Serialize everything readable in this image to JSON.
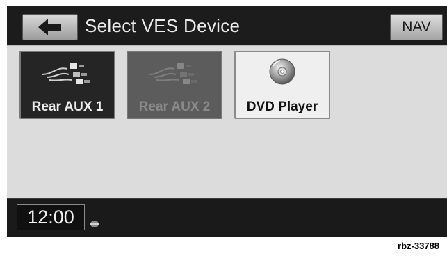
{
  "header": {
    "title": "Select VES Device",
    "back_icon": "arrow-left-icon",
    "nav_label": "NAV"
  },
  "devices": [
    {
      "label": "Rear AUX 1",
      "icon": "aux-cables-icon",
      "state": "selected"
    },
    {
      "label": "Rear AUX 2",
      "icon": "aux-cables-icon",
      "state": "disabled"
    },
    {
      "label": "DVD Player",
      "icon": "disc-icon",
      "state": "enabled"
    }
  ],
  "status_bar": {
    "clock": "12:00",
    "gps_icon": "satellite-icon"
  },
  "caption": "rbz-33788",
  "colors": {
    "header_bg": "#1c1c1c",
    "content_bg": "#dcdcdc",
    "selected_tile": "#252525",
    "disabled_tile": "#5c5c5c",
    "enabled_tile": "#efefef"
  }
}
